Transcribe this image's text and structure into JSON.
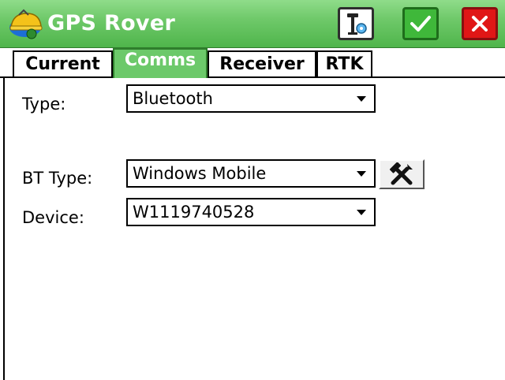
{
  "app": {
    "title": "GPS Rover",
    "icons": {
      "app": "hardhat-satellite-icon",
      "settings": "receiver-settings-icon",
      "accept": "checkmark-icon",
      "close": "close-icon",
      "tools": "hammer-wrench-icon",
      "dropdown": "chevron-down-icon"
    },
    "colors": {
      "titlebar": "#6fc96a",
      "accept": "#3fb83a",
      "close": "#e01616"
    }
  },
  "tabs": [
    {
      "label": "Current",
      "active": false
    },
    {
      "label": "Comms",
      "active": true
    },
    {
      "label": "Receiver",
      "active": false
    },
    {
      "label": "RTK",
      "active": false
    }
  ],
  "form": {
    "type": {
      "label": "Type:",
      "value": "Bluetooth"
    },
    "bt_type": {
      "label": "BT Type:",
      "value": "Windows Mobile"
    },
    "device": {
      "label": "Device:",
      "value": "W1119740528"
    }
  }
}
